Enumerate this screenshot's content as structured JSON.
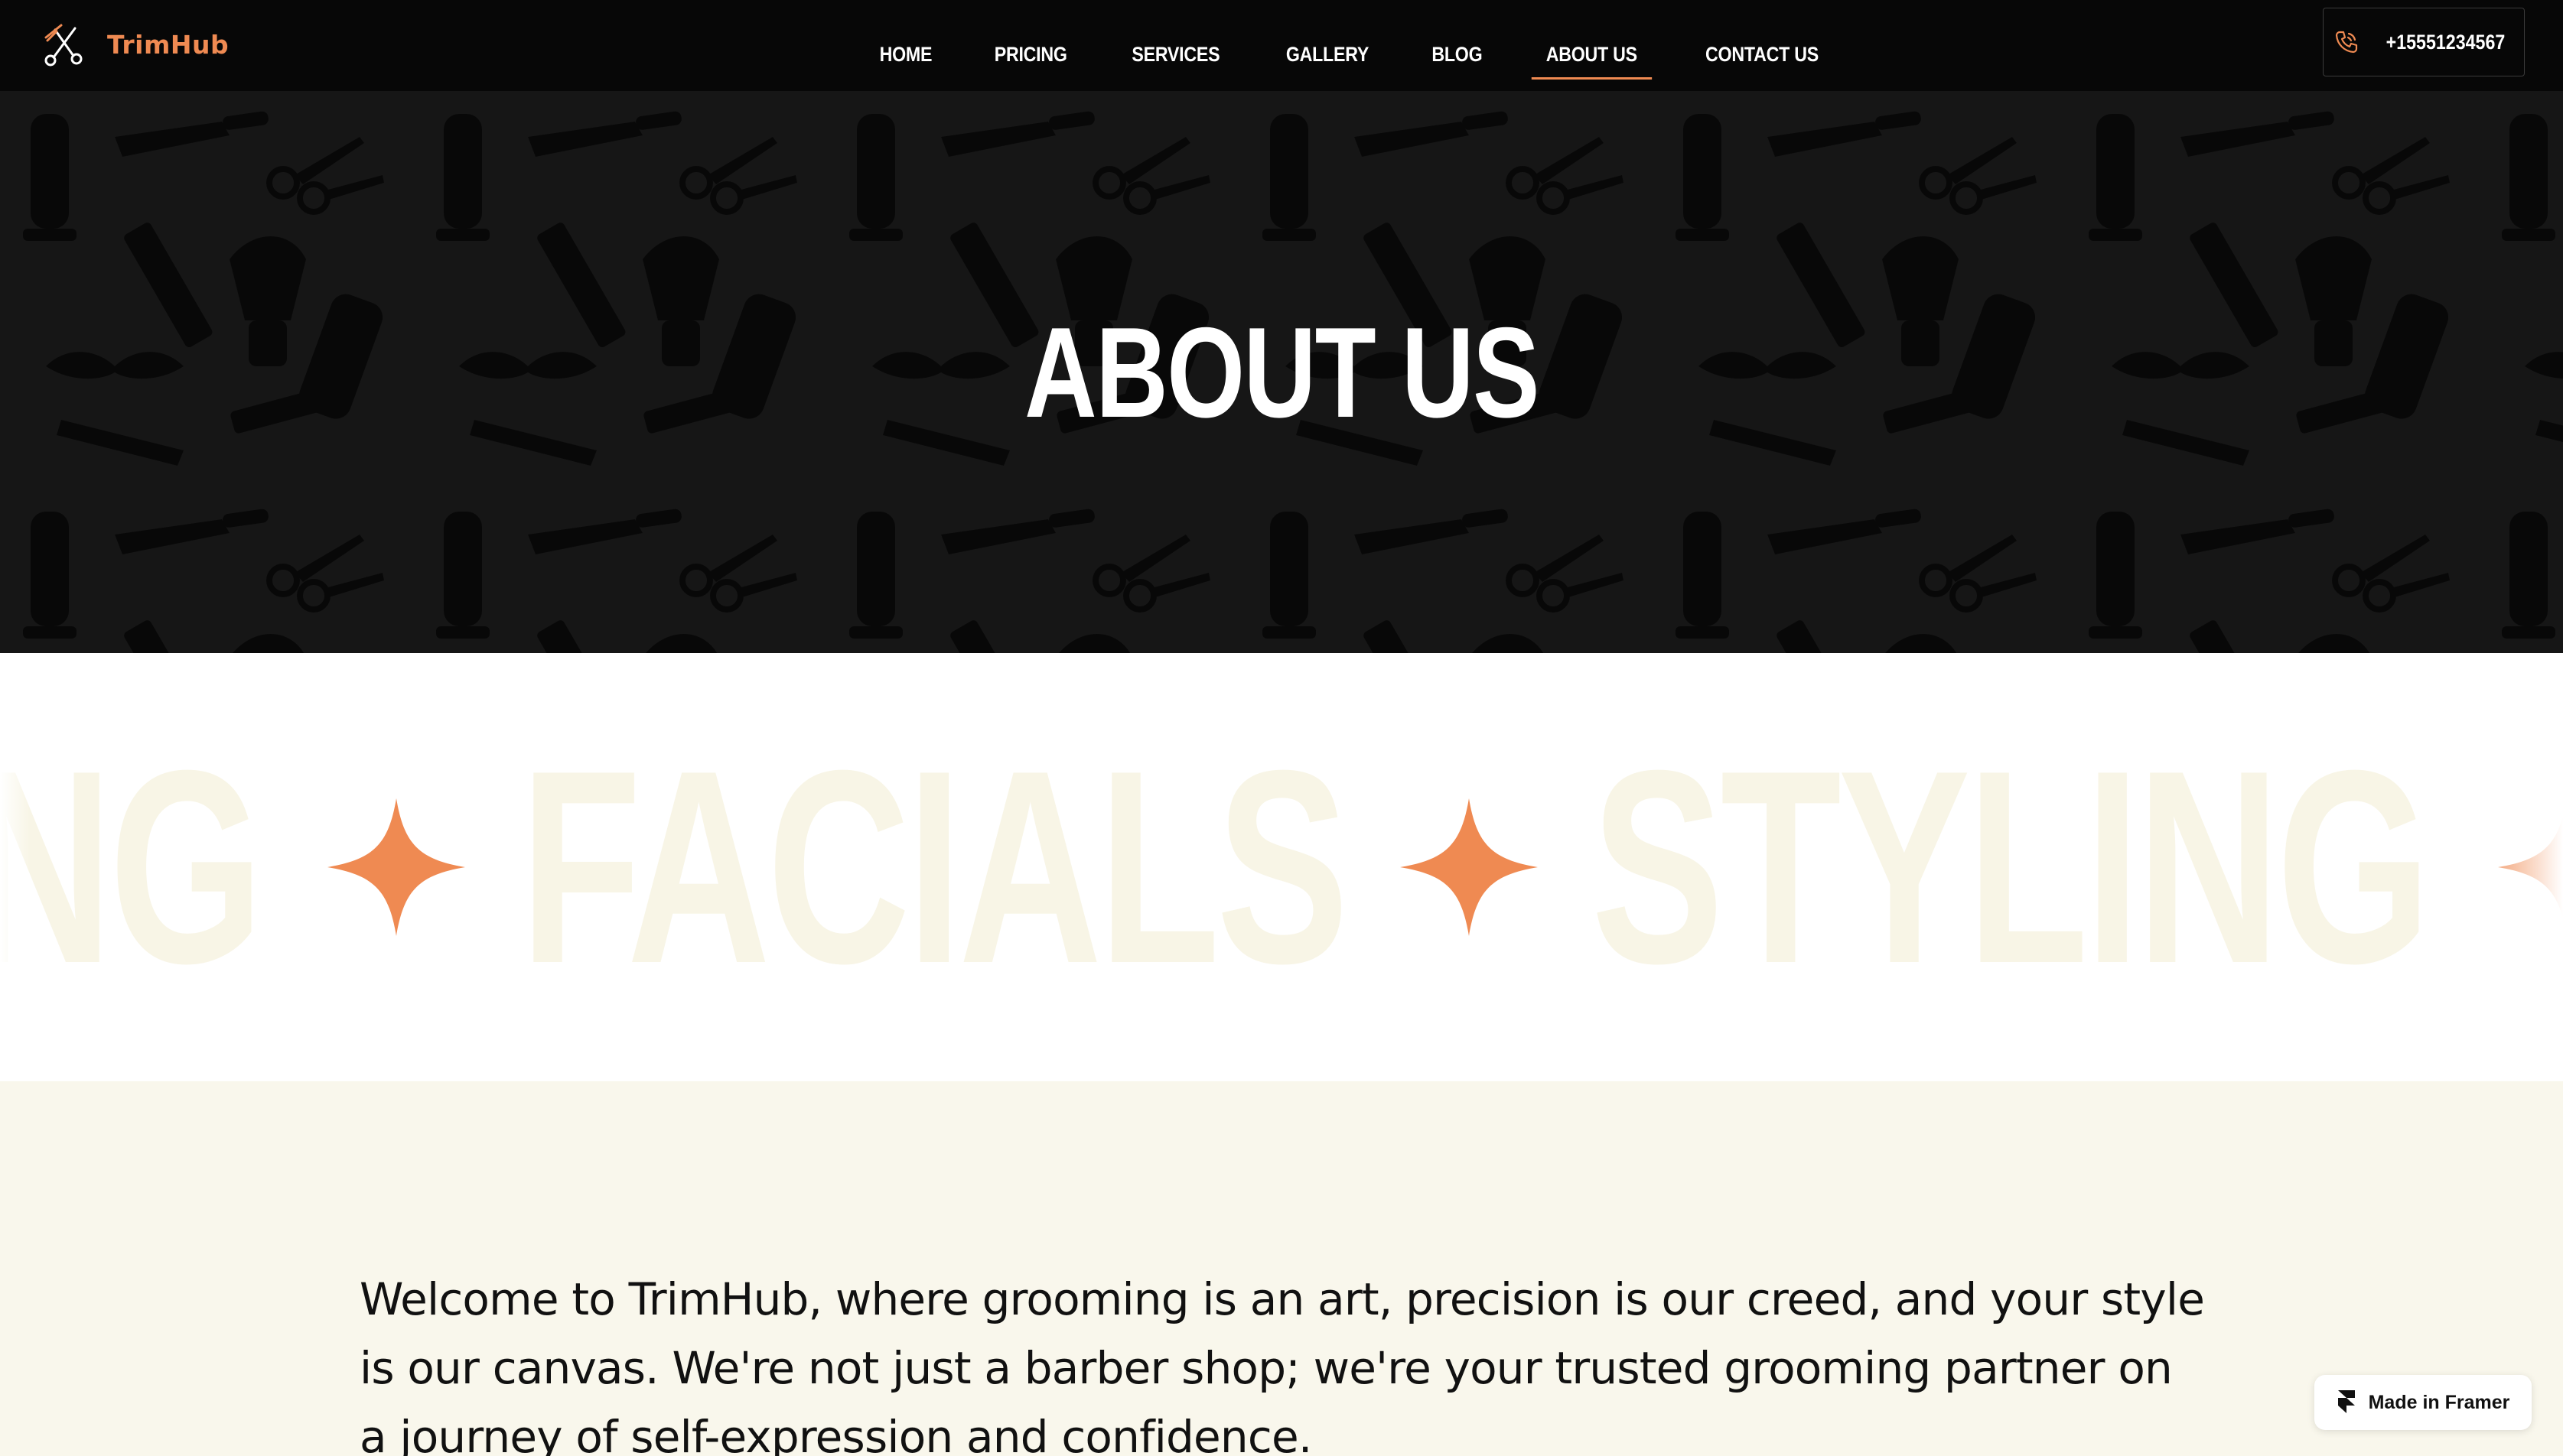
{
  "brand": {
    "name": "TrimHub",
    "accent": "#ef8a52"
  },
  "nav": {
    "items": [
      {
        "label": "HOME"
      },
      {
        "label": "PRICING"
      },
      {
        "label": "SERVICES"
      },
      {
        "label": "GALLERY"
      },
      {
        "label": "BLOG"
      },
      {
        "label": "ABOUT US",
        "active": true
      },
      {
        "label": "CONTACT US"
      }
    ],
    "phone": "+15551234567",
    "phone_icon": "phone-icon"
  },
  "hero": {
    "title": "ABOUT US",
    "background_pattern": "barber-tools-pattern"
  },
  "marquee": {
    "words": [
      "NG",
      "FACIALS",
      "STYLING"
    ],
    "separator_icon": "four-point-star-icon"
  },
  "about": {
    "text": "Welcome to TrimHub, where grooming is an art, precision is our creed, and your style is our canvas. We're not just a barber shop; we're your trusted grooming partner on a journey of self-expression and confidence."
  },
  "badge": {
    "label": "Made in Framer",
    "icon": "framer-icon"
  }
}
